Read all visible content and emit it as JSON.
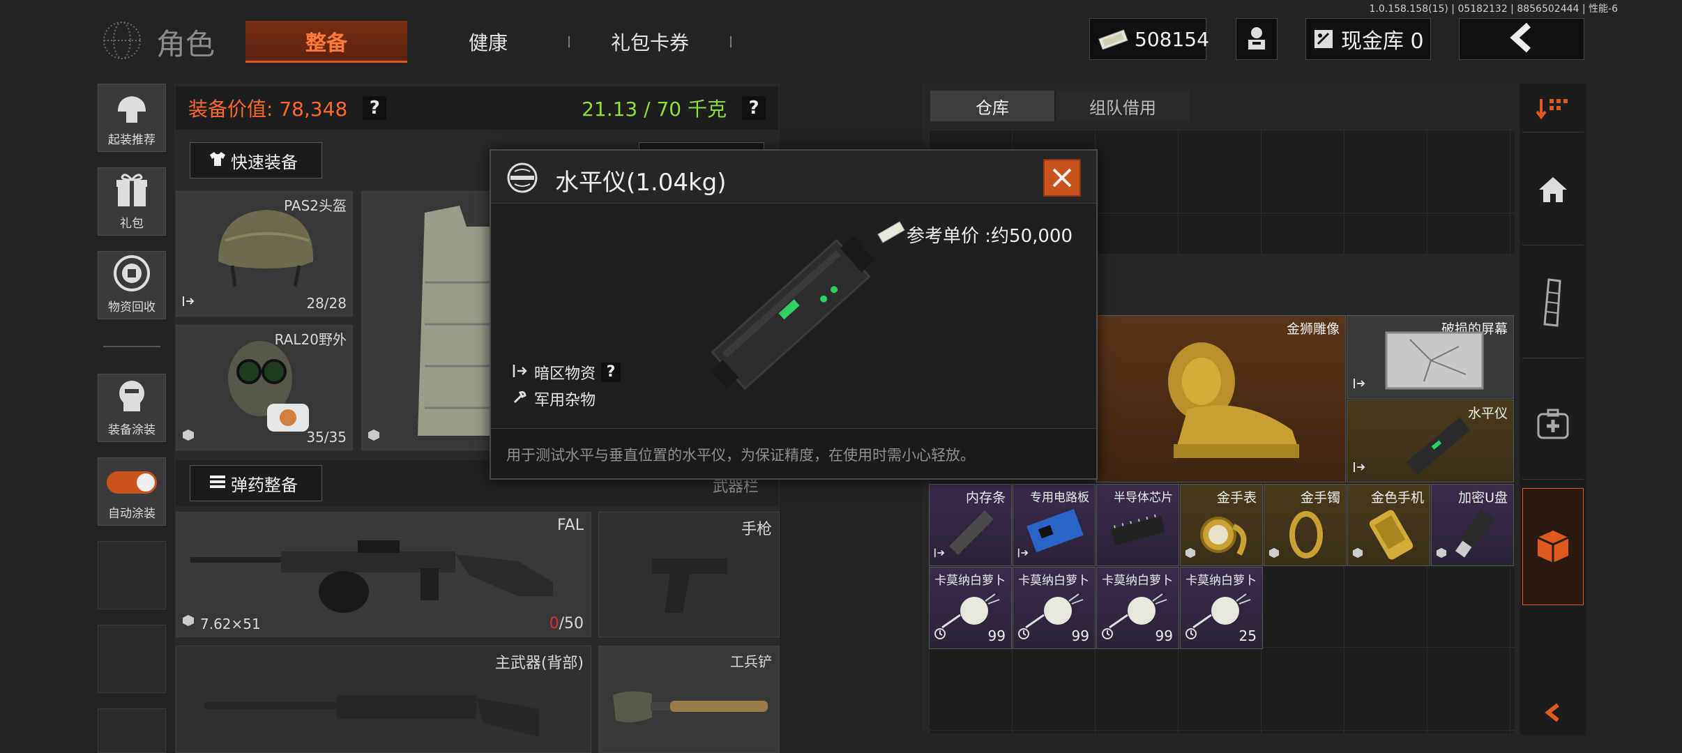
{
  "version_info": "1.0.158.158(15) | 05182132 | 8856502444 | 性能-6",
  "header": {
    "title": "角色",
    "tabs": [
      {
        "label": "整备",
        "active": true
      },
      {
        "label": "健康",
        "active": false
      },
      {
        "label": "礼包卡券",
        "active": false
      }
    ],
    "currency_value": "508154",
    "vault_label": "现金库 0"
  },
  "sidebar": {
    "items": [
      {
        "label": "起装推荐",
        "icon": "loadout-icon"
      },
      {
        "label": "礼包",
        "icon": "gift-icon"
      },
      {
        "label": "物资回收",
        "icon": "recycle-icon"
      },
      {
        "label": "装备涂装",
        "icon": "paint-icon"
      },
      {
        "label": "自动涂装",
        "icon": "toggle-icon"
      }
    ]
  },
  "loadout": {
    "value_label": "装备价值: 78,348",
    "weight_label": "21.13 / 70 千克",
    "help": "?",
    "quick_equip": "快速装备",
    "ammo_equip": "弹药整备",
    "weapon_bar": "武器栏",
    "helmet": {
      "name": "PAS2头盔",
      "durability": "28/28"
    },
    "mask": {
      "name": "RAL20野外",
      "durability": "35/35"
    },
    "primary": {
      "name": "FAL",
      "caliber": "7.62×51",
      "ammo_current": "0",
      "ammo_max": "/50"
    },
    "pistol": {
      "name": "手枪"
    },
    "back_weapon": {
      "name": "主武器(背部)"
    },
    "shovel": {
      "name": "工兵铲"
    }
  },
  "storage": {
    "tabs": [
      {
        "label": "仓库",
        "active": true
      },
      {
        "label": "组队借用",
        "active": false
      }
    ],
    "items": [
      {
        "name": "金狮雕像",
        "rarity": "orange"
      },
      {
        "name": "破损的屏幕",
        "rarity": "gray"
      },
      {
        "name": "水平仪",
        "rarity": "gold"
      },
      {
        "name": "内存条",
        "rarity": "purple"
      },
      {
        "name": "专用电路板",
        "rarity": "purple"
      },
      {
        "name": "半导体芯片",
        "rarity": "purple"
      },
      {
        "name": "金手表",
        "rarity": "gold"
      },
      {
        "name": "金手镯",
        "rarity": "gold"
      },
      {
        "name": "金色手机",
        "rarity": "gold"
      },
      {
        "name": "加密U盘",
        "rarity": "purple"
      },
      {
        "name": "卡莫纳白萝卜",
        "count": "99"
      },
      {
        "name": "卡莫纳白萝卜",
        "count": "99"
      },
      {
        "name": "卡莫纳白萝卜",
        "count": "99"
      },
      {
        "name": "卡莫纳白萝卜",
        "count": "25"
      }
    ]
  },
  "popup": {
    "title": "水平仪(1.04kg)",
    "price": "参考单价 :约50,000",
    "tag1": "暗区物资",
    "tag2": "军用杂物",
    "help": "?",
    "description": "用于测试水平与垂直位置的水平仪，为保证精度，在使用时需小心轻放。"
  },
  "colors": {
    "accent": "#e05a1e",
    "value_text": "#ff6a2a",
    "weight_text": "#8fe03a",
    "ammo_empty": "#e03030"
  }
}
